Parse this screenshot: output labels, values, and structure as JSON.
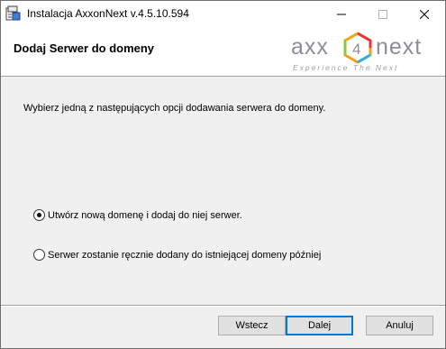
{
  "window": {
    "title": "Instalacja AxxonNext v.4.5.10.594",
    "icon": "installer-icon"
  },
  "banner": {
    "title": "Dodaj Serwer do domeny",
    "logo": {
      "left": "axx",
      "digit": "4",
      "right": "next",
      "tagline": "Experience The Next",
      "colors": [
        "#8a8f95",
        "#f6a019",
        "#e8343c",
        "#23b3e8",
        "#8cc63f"
      ]
    }
  },
  "content": {
    "instruction": "Wybierz jedną z następujących opcji dodawania serwera do domeny.",
    "options": [
      {
        "label": "Utwórz nową domenę i dodaj do niej serwer.",
        "checked": true
      },
      {
        "label": "Serwer zostanie ręcznie dodany do istniejącej domeny później",
        "checked": false
      }
    ]
  },
  "buttons": {
    "back": "Wstecz",
    "next": "Dalej",
    "cancel": "Anuluj"
  }
}
